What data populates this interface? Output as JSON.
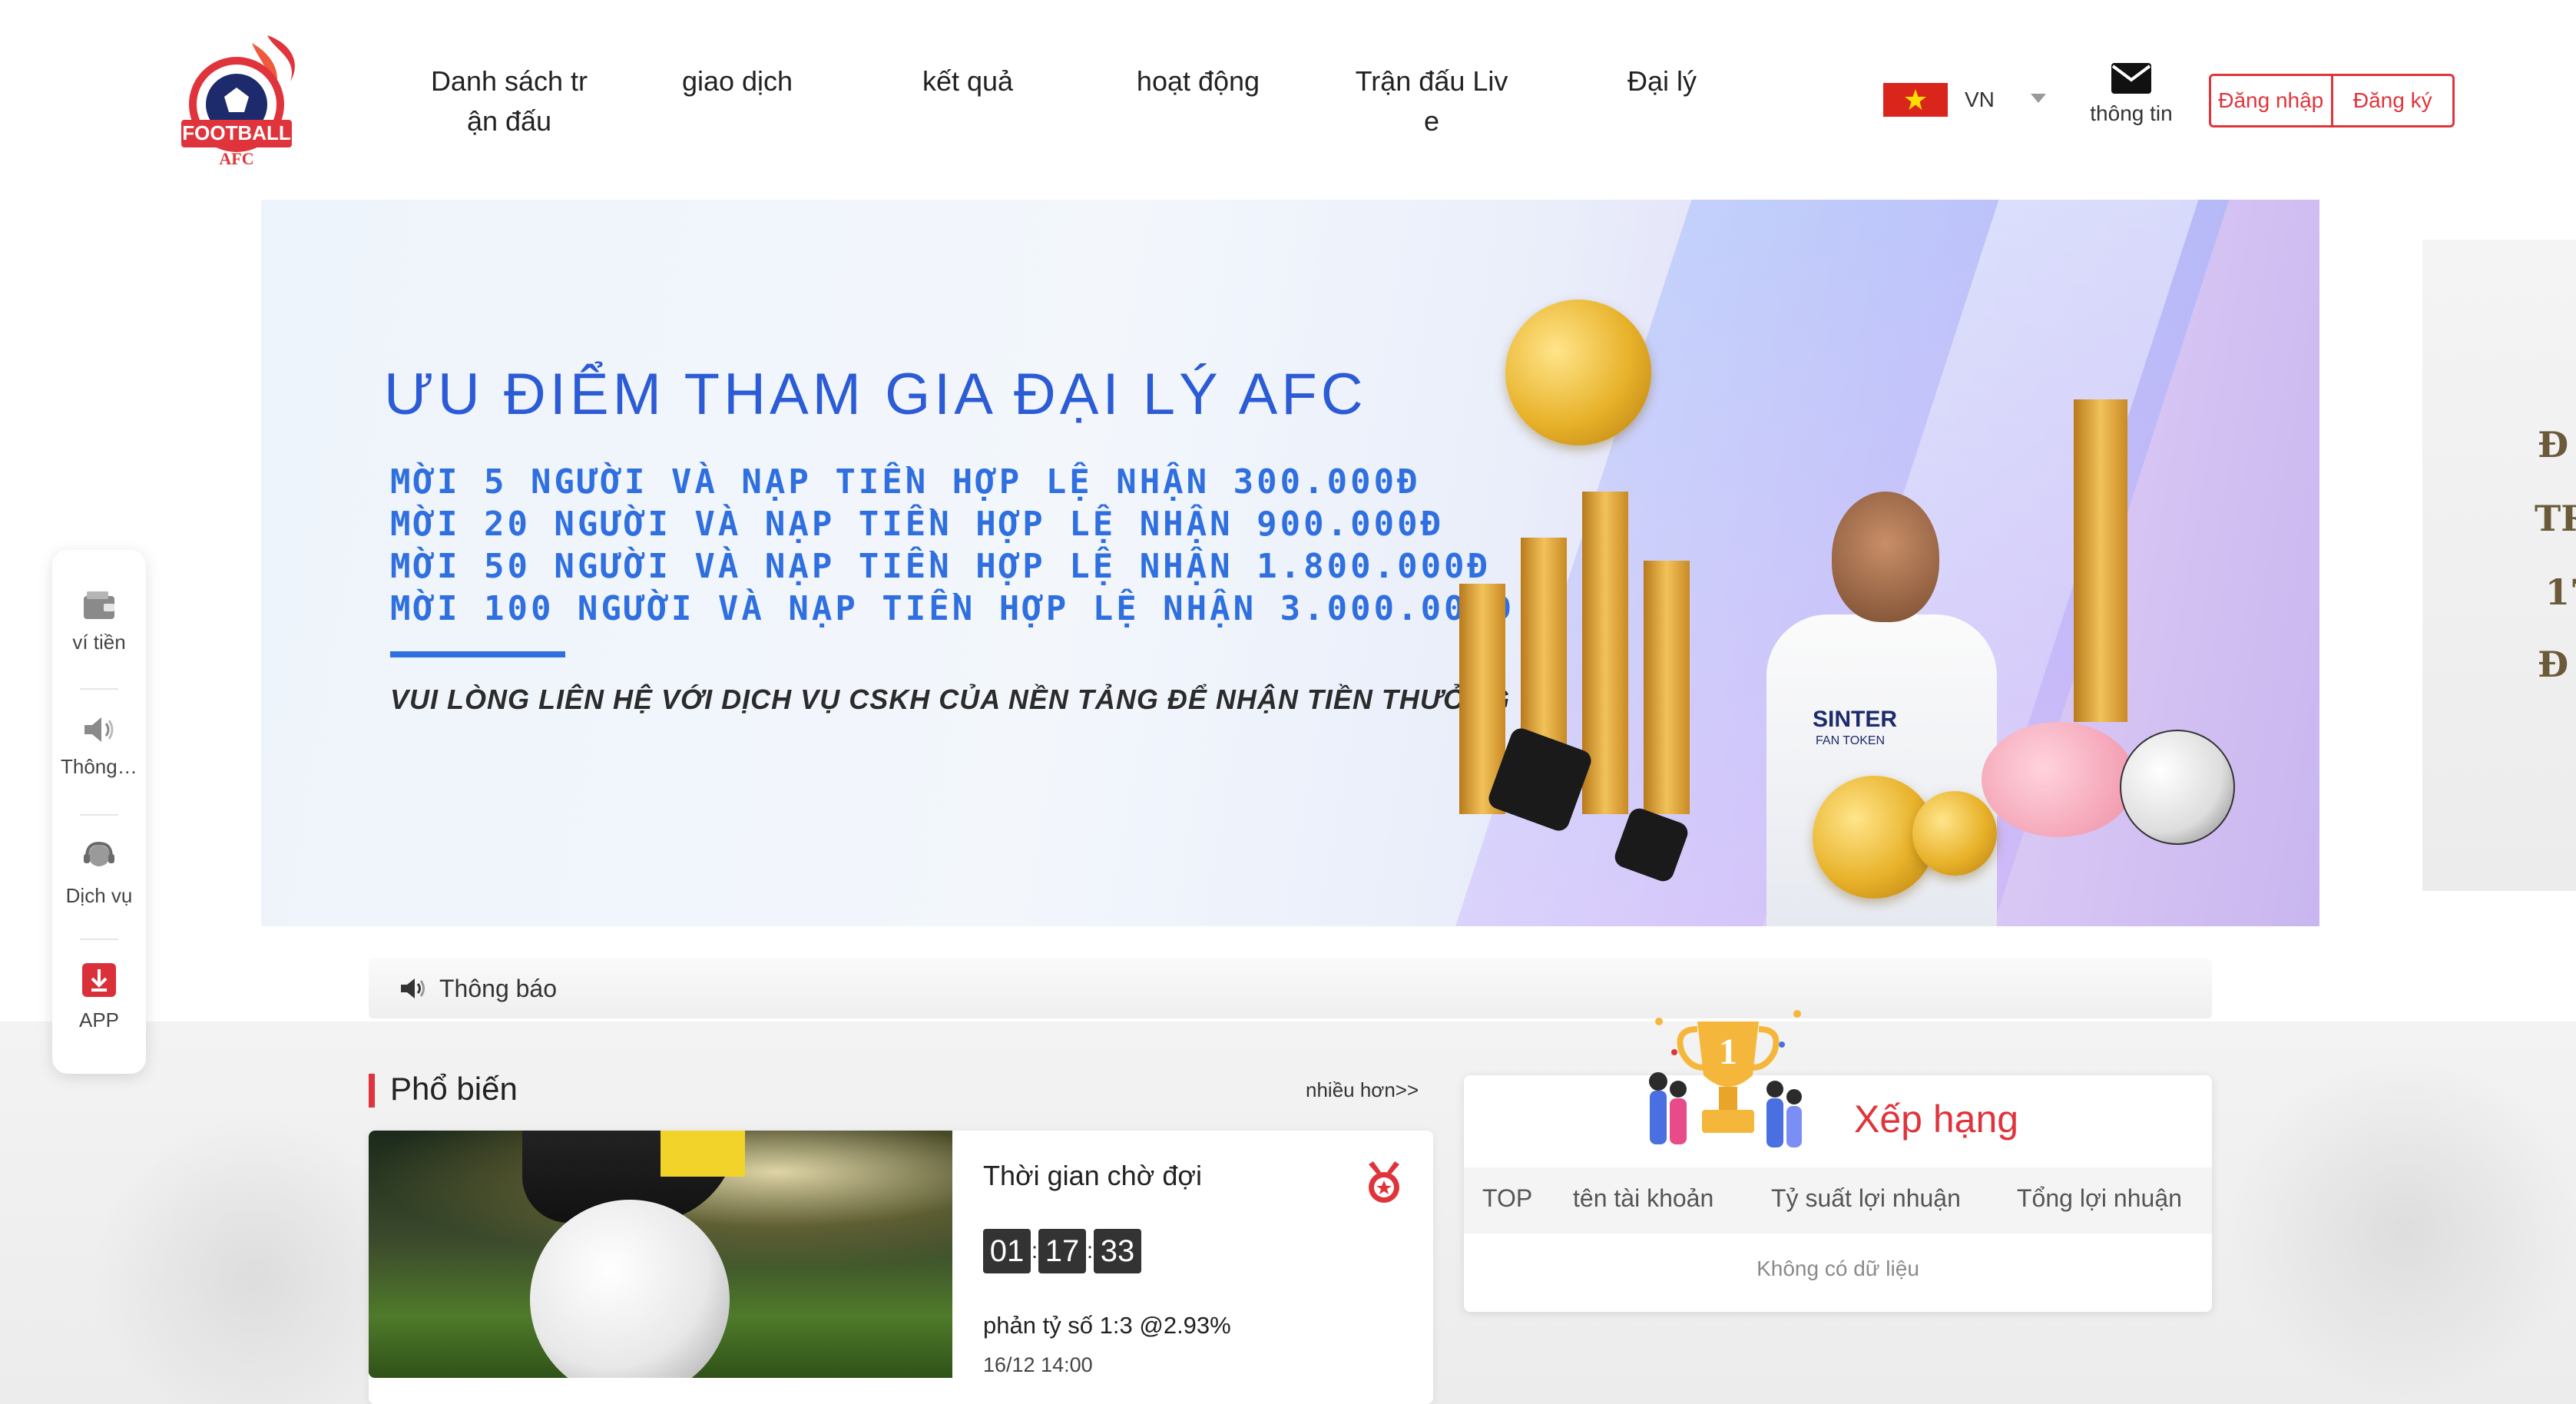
{
  "brand": {
    "logo_text": "FOOTBALL",
    "logo_sub": "AFC"
  },
  "nav": {
    "items": [
      {
        "label_line1": "Danh sách tr",
        "label_line2": "ận đấu"
      },
      {
        "label_line1": "giao dịch",
        "label_line2": ""
      },
      {
        "label_line1": "kết quả",
        "label_line2": ""
      },
      {
        "label_line1": "hoạt động",
        "label_line2": ""
      },
      {
        "label_line1": "Trận đấu Liv",
        "label_line2": "e"
      },
      {
        "label_line1": "Đại lý",
        "label_line2": ""
      }
    ]
  },
  "header": {
    "language_code": "VN",
    "mail_label": "thông tin",
    "login_label": "Đăng nhập",
    "register_label": "Đăng ký"
  },
  "banner": {
    "title": "ƯU ĐIỂM  THAM GIA ĐẠI LÝ AFC",
    "lines": [
      "MỜI 5 NGƯỜI VÀ NẠP TIỀN HỢP LỆ NHẬN 300.000Đ",
      "MỜI 20 NGƯỜI VÀ NẠP TIỀN HỢP LỆ NHẬN 900.000Đ",
      "MỜI 50 NGƯỜI VÀ NẠP TIỀN HỢP LỆ NHẬN 1.800.000Đ",
      "MỜI 100 NGƯỜI VÀ NẠP TIỀN HỢP LỆ NHẬN 3.000.000Đ"
    ],
    "contact": "VUI LÒNG LIÊN HỆ VỚI DỊCH VỤ CSKH CỦA NỀN TẢNG ĐỂ NHẬN TIỀN THƯỞNG",
    "jersey_text": "SINTER",
    "jersey_sub": "FAN TOKEN"
  },
  "peek_slide": {
    "chars": [
      "Đ",
      "TR",
      "17",
      "Đ"
    ]
  },
  "sidebar": {
    "items": [
      {
        "label": "ví tiền",
        "icon": "wallet-icon"
      },
      {
        "label": "Thông báo",
        "icon": "speaker-icon"
      },
      {
        "label": "Dịch vụ",
        "icon": "support-icon"
      },
      {
        "label": "APP",
        "icon": "download-icon"
      }
    ]
  },
  "notice": {
    "label": "Thông báo"
  },
  "popular": {
    "title": "Phổ biến",
    "more": "nhiều hơn>>",
    "match": {
      "wait_label": "Thời gian chờ đợi",
      "timer": [
        "01",
        "17",
        "33"
      ],
      "odds": "phản tỷ số 1:3 @2.93%",
      "time": "16/12 14:00"
    }
  },
  "ranking": {
    "title": "Xếp hạng",
    "trophy_number": "1",
    "columns": [
      "TOP",
      "tên tài khoản",
      "Tỷ suất lợi nhuận",
      "Tổng lợi nhuận"
    ],
    "empty": "Không có dữ liệu"
  },
  "colors": {
    "accent": "#e0343c",
    "banner_blue": "#2f6fe0"
  }
}
